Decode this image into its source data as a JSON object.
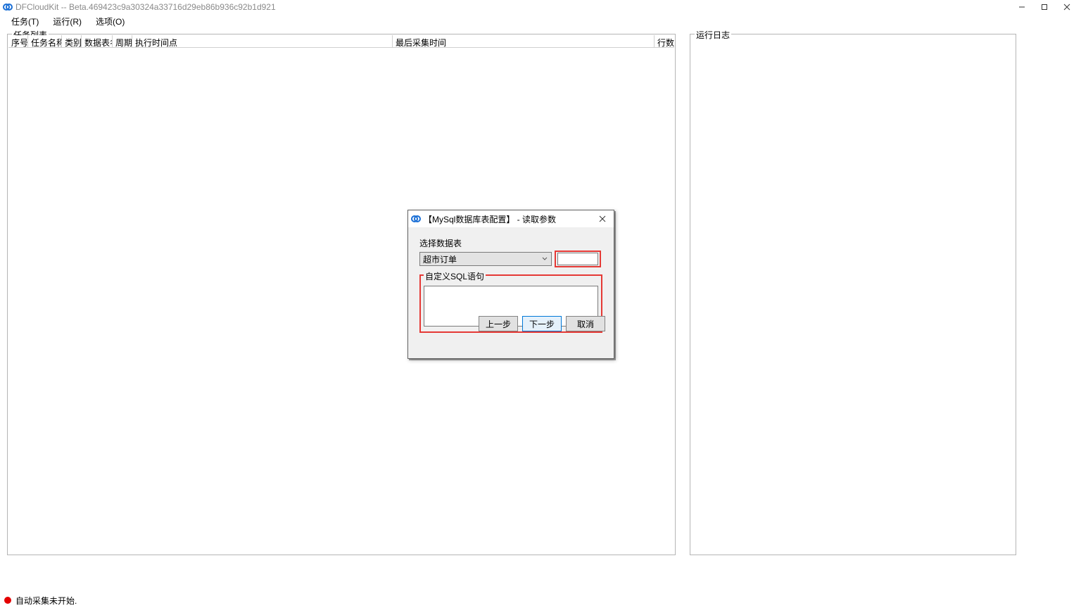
{
  "window": {
    "title": "DFCloudKit -- Beta.469423c9a30324a33716d29eb86b936c92b1d921"
  },
  "menu": {
    "task": "任务(T)",
    "run": "运行(R)",
    "options": "选项(O)"
  },
  "groups": {
    "task_list": "任务列表",
    "log": "运行日志"
  },
  "columns": {
    "seq": "序号",
    "task_name": "任务名称",
    "category": "类别",
    "table_name": "数据表名",
    "period": "周期",
    "exec_point": "执行时间点",
    "last_collect": "最后采集时间",
    "rows": "行数"
  },
  "dialog": {
    "title": "【MySql数据库表配置】 - 读取参数",
    "select_table_label": "选择数据表",
    "selected_table": "超市订单",
    "filter_value": "",
    "sql_legend": "自定义SQL语句",
    "sql_value": "",
    "prev": "上一步",
    "next": "下一步",
    "cancel": "取消"
  },
  "status": {
    "text": "自动采集未开始."
  }
}
